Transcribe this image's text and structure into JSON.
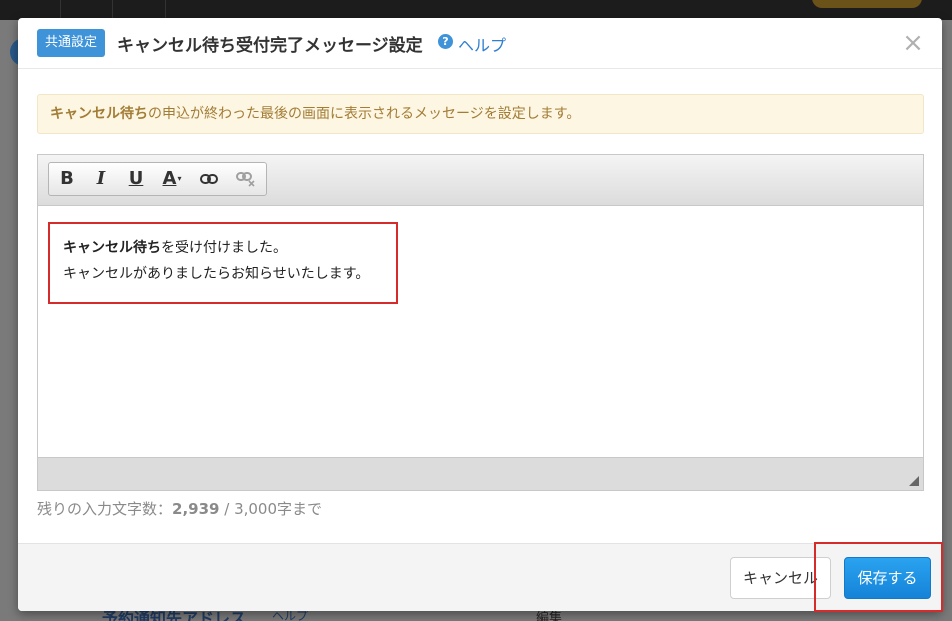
{
  "background": {
    "section_title": "予約通知先アドレス",
    "help": "ヘルプ",
    "edit": "編集"
  },
  "modal": {
    "badge": "共通設定",
    "title": "キャンセル待ち受付完了メッセージ設定",
    "help_icon": "?",
    "help_label": "ヘルプ",
    "close": "×",
    "notice": {
      "bold": "キャンセル待ち",
      "rest": "の申込が終わった最後の画面に表示されるメッセージを設定します。"
    },
    "toolbar": {
      "bold": "B",
      "italic": "I",
      "underline": "U",
      "font_color": "A",
      "caret": "▾"
    },
    "message": {
      "line1_bold": "キャンセル待ち",
      "line1_rest": "を受け付けました。",
      "line2": "キャンセルがありましたらお知らせいたします。"
    },
    "char_count": {
      "prefix": "残りの入力文字数：",
      "remaining": "2,939",
      "separator": " / ",
      "max": "3,000字まで"
    },
    "buttons": {
      "cancel": "キャンセル",
      "save": "保存する"
    }
  },
  "colors": {
    "accent": "#3f93d8",
    "save_button": "#1a8fe3",
    "highlight_box": "#d62b2b",
    "notice_bg": "#fcf6e3",
    "notice_text": "#a37c35"
  },
  "icons": [
    "help-icon",
    "close-icon",
    "link-icon",
    "unlink-icon",
    "resize-handle-icon"
  ]
}
